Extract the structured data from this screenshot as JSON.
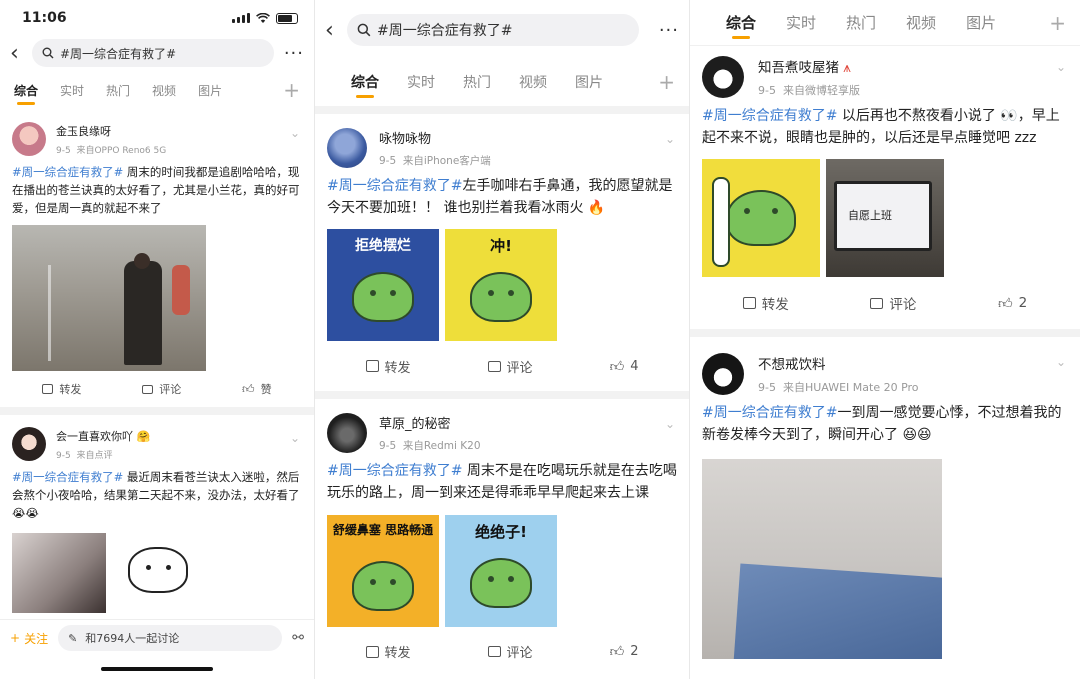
{
  "panel1": {
    "status": {
      "time": "11:06"
    },
    "search": {
      "query": "#周一综合症有救了#"
    },
    "tabs": [
      "综合",
      "实时",
      "热门",
      "视频",
      "图片"
    ],
    "posts": [
      {
        "name": "金玉良缘呀",
        "date": "9-5",
        "source": "来自OPPO Reno6 5G",
        "tag": "#周一综合症有救了#",
        "text": " 周末的时间我都是追剧哈哈哈，现在播出的苍兰诀真的太好看了，尤其是小兰花，真的好可爱，但是周一真的就起不来了",
        "actions": {
          "repost": "转发",
          "comment": "评论",
          "like": "赞"
        }
      },
      {
        "name": "会一直喜欢你吖",
        "date": "9-5",
        "source": "来自点评",
        "tag": "#周一综合症有救了#",
        "text": " 最近周末看苍兰诀太入迷啦，然后会熬个小夜哈哈，结果第二天起不来，没办法，太好看了"
      }
    ],
    "bottom": {
      "follow": "关注",
      "discuss": "和7694人一起讨论"
    }
  },
  "panel2": {
    "search": {
      "query": "#周一综合症有救了#"
    },
    "tabs": [
      "综合",
      "实时",
      "热门",
      "视频",
      "图片"
    ],
    "posts": [
      {
        "name": "咏物咏物",
        "date": "9-5",
        "source": "来自iPhone客户端",
        "tag": "#周一综合症有救了#",
        "text": "左手咖啡右手鼻通，我的愿望就是今天不要加班！！ 谁也别拦着我看冰雨火",
        "stickers": [
          "拒绝摆烂",
          "冲!"
        ],
        "actions": {
          "repost": "转发",
          "comment": "评论",
          "like": "4"
        }
      },
      {
        "name": "草原_的秘密",
        "date": "9-5",
        "source": "来自Redmi K20",
        "tag": "#周一综合症有救了#",
        "text": " 周末不是在吃喝玩乐就是在去吃喝玩乐的路上，周一到来还是得乖乖早早爬起来去上课",
        "stickers": [
          "舒缓鼻塞 思路畅通",
          "绝绝子!"
        ],
        "actions": {
          "repost": "转发",
          "comment": "评论",
          "like": "2"
        }
      }
    ]
  },
  "panel3": {
    "tabs": [
      "综合",
      "实时",
      "热门",
      "视频",
      "图片"
    ],
    "posts": [
      {
        "name": "知吾煮吱屋猪",
        "date": "9-5",
        "source": "来自微博轻享版",
        "tag": "#周一综合症有救了#",
        "text": " 以后再也不熬夜看小说了 👀，早上起不来不说，眼睛也是肿的，以后还是早点睡觉吧 zzz",
        "image_text": "自愿上班",
        "actions": {
          "repost": "转发",
          "comment": "评论",
          "like": "2"
        }
      },
      {
        "name": "不想戒饮料",
        "date": "9-5",
        "source": "来自HUAWEI Mate 20 Pro",
        "tag": "#周一综合症有救了#",
        "text": "一到周一感觉要心悸，不过想着我的新卷发棒今天到了，瞬间开心了 😆😆"
      }
    ]
  }
}
